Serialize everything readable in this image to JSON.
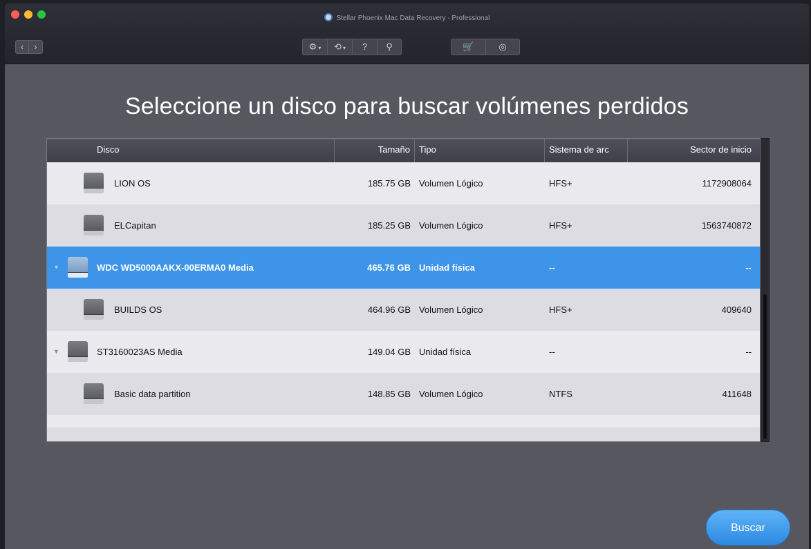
{
  "window": {
    "title": "Stellar Phoenix Mac Data Recovery - Professional"
  },
  "nav": {
    "back_icon": "chevron-left-icon",
    "back": "‹",
    "forward": "›"
  },
  "toolbar": {
    "settings": "⚙",
    "history": "⟲",
    "help": "?",
    "advisor": "⚲",
    "cart": "🛒",
    "account": "◎",
    "caret": "▾"
  },
  "heading": "Seleccione un disco para buscar volúmenes perdidos",
  "table": {
    "columns": [
      "Disco",
      "Tamaño",
      "Tipo",
      "Sistema de arc",
      "Sector de inicio"
    ],
    "rows": [
      {
        "name": "LION OS",
        "size": "185.75 GB",
        "type": "Volumen Lógico",
        "fs": "HFS+",
        "sector": "1172908064",
        "kind": "volume"
      },
      {
        "name": "ELCapitan",
        "size": "185.25 GB",
        "type": "Volumen Lógico",
        "fs": "HFS+",
        "sector": "1563740872",
        "kind": "volume"
      },
      {
        "name": "WDC WD5000AAKX-00ERMA0 Media",
        "size": "465.76 GB",
        "type": "Unidad física",
        "fs": "--",
        "sector": "--",
        "kind": "physical",
        "selected": true
      },
      {
        "name": "BUILDS OS",
        "size": "464.96 GB",
        "type": "Volumen Lógico",
        "fs": "HFS+",
        "sector": "409640",
        "kind": "volume"
      },
      {
        "name": "ST3160023AS Media",
        "size": "149.04 GB",
        "type": "Unidad física",
        "fs": "--",
        "sector": "--",
        "kind": "physical"
      },
      {
        "name": "Basic data partition",
        "size": "148.85 GB",
        "type": "Volumen Lógico",
        "fs": "NTFS",
        "sector": "411648",
        "kind": "volume"
      }
    ],
    "expand_glyph": "▼"
  },
  "actions": {
    "search": "Buscar"
  },
  "colors": {
    "selection": "#3d94e8",
    "accent_button": "#2d88e2",
    "background": "#57585f"
  }
}
